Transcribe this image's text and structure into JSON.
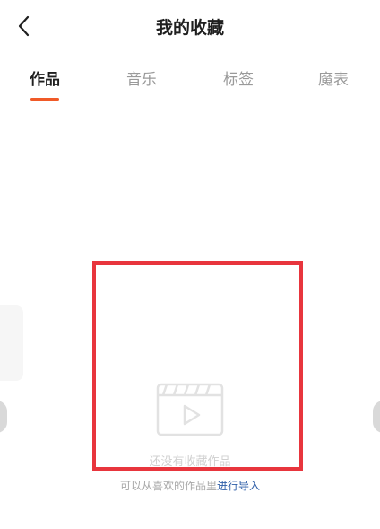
{
  "header": {
    "title": "我的收藏",
    "back_icon": "chevron-left-icon"
  },
  "tabs": [
    {
      "label": "作品",
      "active": true
    },
    {
      "label": "音乐",
      "active": false
    },
    {
      "label": "标签",
      "active": false
    },
    {
      "label": "魔表",
      "active": false
    }
  ],
  "colors": {
    "accent": "#f05a28",
    "highlight": "#e8353d",
    "link": "#2e5ea8"
  },
  "empty_state": {
    "icon": "video-clapperboard-icon",
    "message": "还没有收藏作品",
    "hint_prefix": "可以从喜欢的作品里",
    "hint_link": "进行导入"
  }
}
